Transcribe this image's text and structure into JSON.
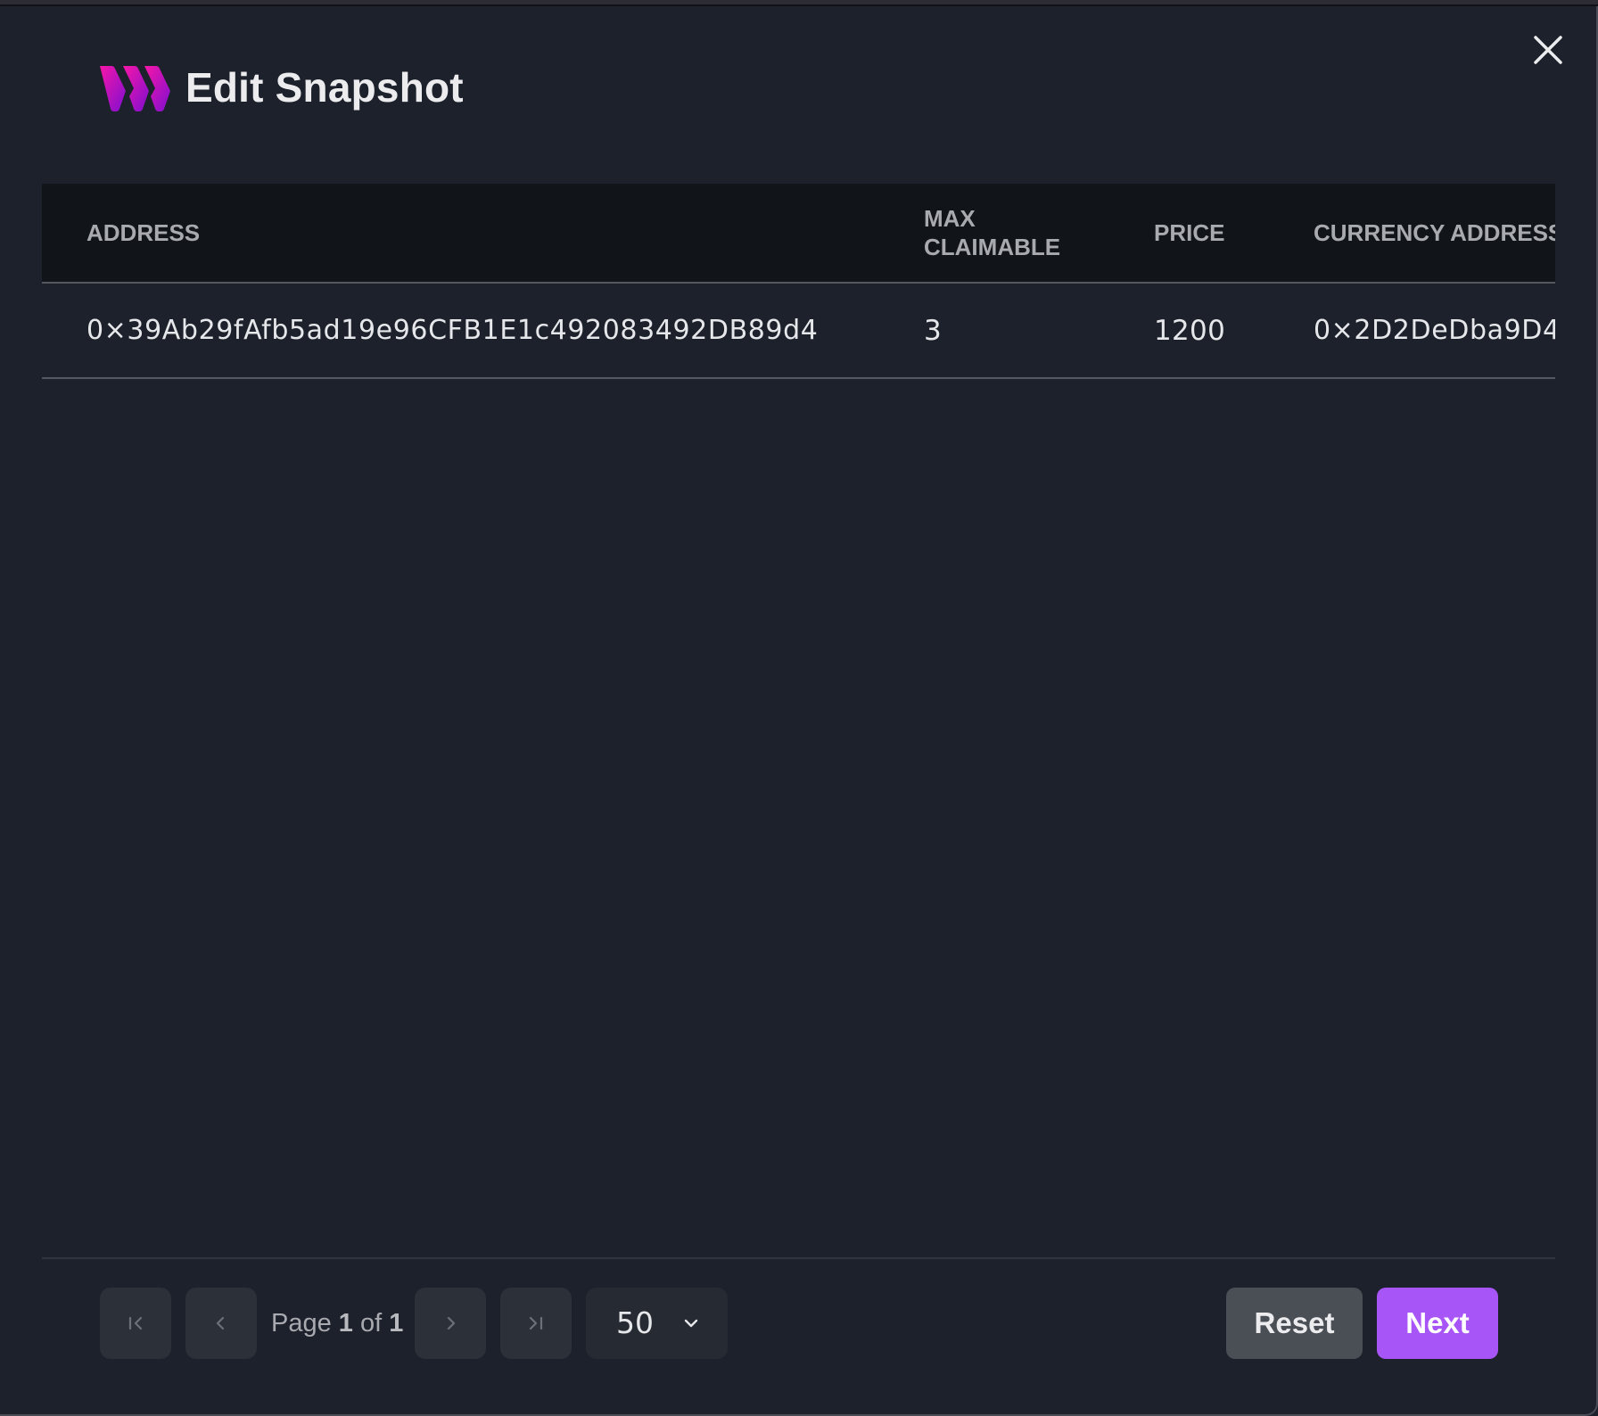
{
  "modal": {
    "title": "Edit Snapshot",
    "close_icon": "close-icon",
    "logo_icon": "brand-logo-icon"
  },
  "colors": {
    "background": "#1c212b",
    "table_header_bg": "#111419",
    "accent": "#a855f7",
    "reset_button_bg": "#4a4f56",
    "logo_gradient_start": "#f213a4",
    "logo_gradient_end": "#8b0fd0"
  },
  "table": {
    "columns": [
      {
        "key": "address",
        "label": "ADDRESS"
      },
      {
        "key": "max_claimable",
        "label": "MAX CLAIMABLE"
      },
      {
        "key": "price",
        "label": "PRICE"
      },
      {
        "key": "currency_address",
        "label": "CURRENCY ADDRESS"
      }
    ],
    "rows": [
      {
        "address": "0×39Ab29fAfb5ad19e96CFB1E1c492083492DB89d4",
        "max_claimable": "3",
        "price": "1200",
        "currency_address": "0×2D2DeDba9D4"
      }
    ]
  },
  "pagination": {
    "first_icon": "first-page-icon",
    "prev_icon": "chevron-left-icon",
    "next_icon": "chevron-right-icon",
    "last_icon": "last-page-icon",
    "page_label": "Page",
    "current_page": "1",
    "of_label": "of",
    "total_pages": "1",
    "page_size": "50",
    "page_size_icon": "chevron-down-icon"
  },
  "actions": {
    "reset_label": "Reset",
    "next_label": "Next"
  }
}
